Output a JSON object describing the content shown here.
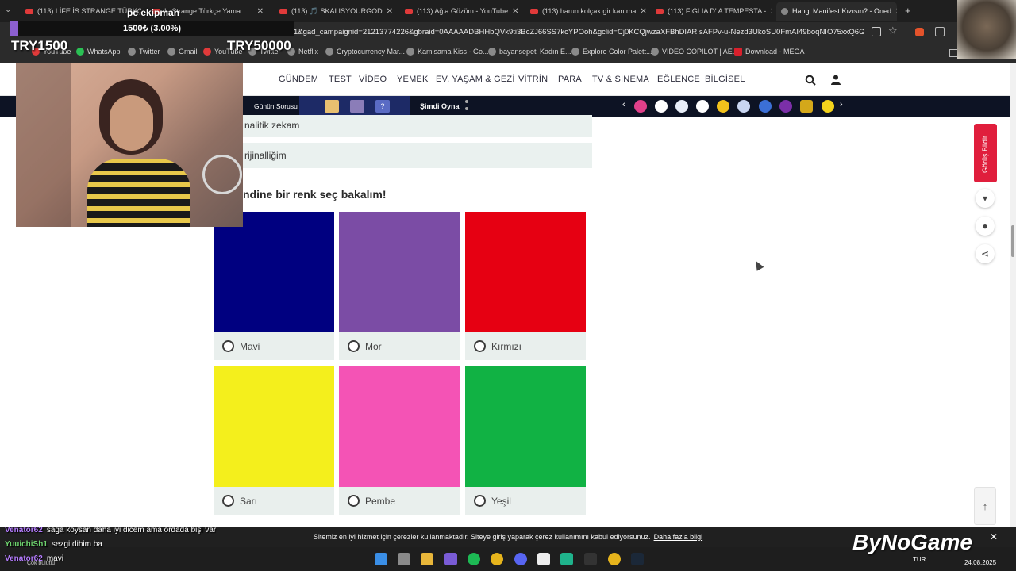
{
  "browser": {
    "tabs": [
      {
        "title": "(113) LİFE İS STRANGE TÜRKÇE",
        "icon": "youtube-icon"
      },
      {
        "title": "Is Strange Türkçe Yama",
        "icon": "youtube-icon"
      },
      {
        "title": "(113) 🎵 SKAI ISYOURGOD",
        "icon": "youtube-icon"
      },
      {
        "title": "(113) Ağla Gözüm - YouTube",
        "icon": "youtube-icon"
      },
      {
        "title": "(113) harun kolçak gir kanıma",
        "icon": "youtube-icon"
      },
      {
        "title": "(113) FIGLIA D' A TEMPESTA -",
        "icon": "youtube-icon"
      },
      {
        "title": "Hangi Manifest Kızısın? - Oned",
        "icon": "globe-icon"
      }
    ],
    "new_tab": "+",
    "url": "1&gad_campaignid=21213774226&gbraid=0AAAAADBHHbQVk9ti3BcZJ66SS7kcYPOoh&gclid=Cj0KCQjwzaXFBhDIARIsAFPv-u-Nezd3UkoSU0FmAI49boqNIO75xxQ6GUhv9...",
    "bookmarks": [
      "YouTube",
      "WhatsApp",
      "Twitter",
      "Gmail",
      "YouTube",
      "Twitter",
      "Netflix",
      "Cryptocurrency Mar...",
      "Kamisama Kiss - Go...",
      "bayansepeti Kadın E...",
      "Explore Color Palett...",
      "VIDEO COPILOT | AE...",
      "Download - MEGA"
    ]
  },
  "site": {
    "nav": [
      "GÜNDEM",
      "TEST",
      "VİDEO",
      "YEMEK",
      "EV, YAŞAM & GEZİ",
      "VİTRİN",
      "PARA",
      "TV & SİNEMA",
      "EĞLENCE",
      "BİLGİSEL"
    ],
    "gunun_sorusu": "Günün Sorusu",
    "simdi_oyna": "Şimdi Oyna",
    "chip_question": "?",
    "prev_options": [
      "nalitik zekam",
      "rijinalliğim"
    ],
    "question": "ndine bir renk seç bakalım!",
    "colors": [
      {
        "label": "Mavi",
        "color": "#000080"
      },
      {
        "label": "Mor",
        "color": "#7b4ca5"
      },
      {
        "label": "Kırmızı",
        "color": "#e60012"
      },
      {
        "label": "Sarı",
        "color": "#f4ef1c"
      },
      {
        "label": "Pembe",
        "color": "#f453b5"
      },
      {
        "label": "Yeşil",
        "color": "#11b244"
      }
    ],
    "feedback": "Görüş Bildir",
    "cookie_text": "Sitemiz en iyi hizmet için çerezler kullanmaktadır. Siteye giriş yaparak çerez kullanımını kabul ediyorsunuz.",
    "cookie_link": "Daha fazla bilgi"
  },
  "stream": {
    "goal_title": "pc ekipman",
    "goal_progress": "1500₺ (3.00%)",
    "goal_percent": 3.0,
    "goal_min": "TRY1500",
    "goal_max": "TRY50000",
    "brand": "ByNoGame",
    "chat": [
      {
        "user": "Venator62",
        "user_color": "#b57cff",
        "message": "sağa koysan daha iyi dicem ama ordada bişi var"
      },
      {
        "user": "YuuichiSh1",
        "user_color": "#6ed36e",
        "message": "sezgi dihim ba"
      },
      {
        "user": "Venator62",
        "user_color": "#b57cff",
        "message": "mavi"
      }
    ],
    "weather": "Çok bulutlu"
  },
  "taskbar": {
    "lang": "TUR",
    "time": "",
    "date": "24.08.2025"
  }
}
